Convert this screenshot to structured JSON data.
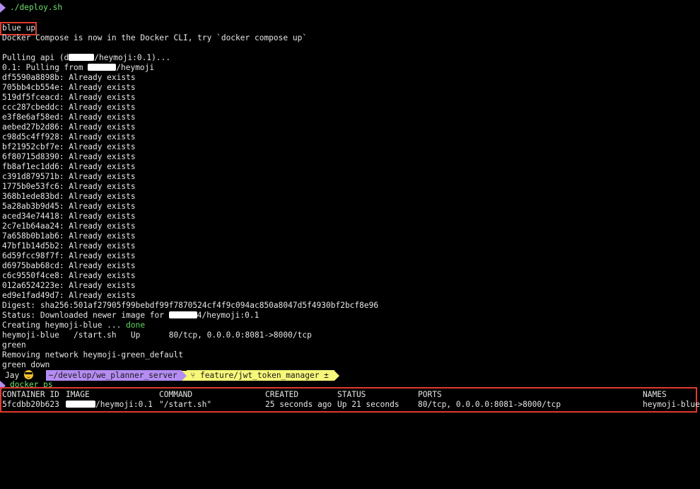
{
  "colors": {
    "background": "#000000",
    "text": "#e6e6e6",
    "prompt_arrow": "#b48cf2",
    "command_green": "#6ee06e",
    "highlight_red": "#e03a2e",
    "path_segment": "#b48cf2",
    "branch_segment": "#f7f77a",
    "done_green": "#5fd75f"
  },
  "top_command": "./deploy.sh",
  "lines": [
    "blue up",
    "Docker Compose is now in the Docker CLI, try `docker compose up`",
    "",
    {
      "pre": "Pulling api (d",
      "post": "/heymoji:0.1)..."
    },
    {
      "pre": "0.1: Pulling from ",
      "post": "/heymoji"
    },
    "df5590a8898b: Already exists",
    "705bb4cb554e: Already exists",
    "519df5fceacd: Already exists",
    "ccc287cbeddc: Already exists",
    "e3f8e6af58ed: Already exists",
    "aebed27b2d86: Already exists",
    "c98d5c4ff928: Already exists",
    "bf21952cbf7e: Already exists",
    "6f80715d8390: Already exists",
    "fb8af1ec1dd6: Already exists",
    "c391d879571b: Already exists",
    "1775b0e53fc6: Already exists",
    "368b1ede83bd: Already exists",
    "5a28ab3b9d45: Already exists",
    "aced34e74418: Already exists",
    "2c7e1b64aa24: Already exists",
    "7a658b0b1ab6: Already exists",
    "47bf1b14d5b2: Already exists",
    "6d59fcc98f7f: Already exists",
    "d6975bab68cd: Already exists",
    "c6c9550f4ce8: Already exists",
    "012a6524223e: Already exists",
    "ed9e1fad49d7: Already exists",
    "Digest: sha256:501af27905f99bebdf99f7870524cf4f9c094ac850a8047d5f4930bf2bcf8e96",
    {
      "pre": "Status: Downloaded newer image for ",
      "post": "4/heymoji:0.1"
    },
    {
      "pre": "Creating heymoji-blue ... ",
      "done": "done"
    },
    "heymoji-blue   /start.sh   Up      80/tcp, 0.0.0.0:8081->8000/tcp",
    "green",
    "Removing network heymoji-green_default",
    "green down"
  ],
  "prompt": {
    "user": "Jay",
    "path": "~/develop/we_planner_server",
    "branch_icon": "branch-icon",
    "branch": "feature/jwt_token_manager ±"
  },
  "second_command": "docker ps",
  "docker_ps": {
    "headers": [
      "CONTAINER ID",
      "IMAGE",
      "COMMAND",
      "CREATED",
      "STATUS",
      "PORTS",
      "NAMES"
    ],
    "rows": [
      [
        "5fcdbb20b623",
        "/heymoji:0.1",
        "\"/start.sh\"",
        "25 seconds ago",
        "Up 21 seconds",
        "80/tcp, 0.0.0.0:8081->8000/tcp",
        "heymoji-blue"
      ]
    ]
  }
}
